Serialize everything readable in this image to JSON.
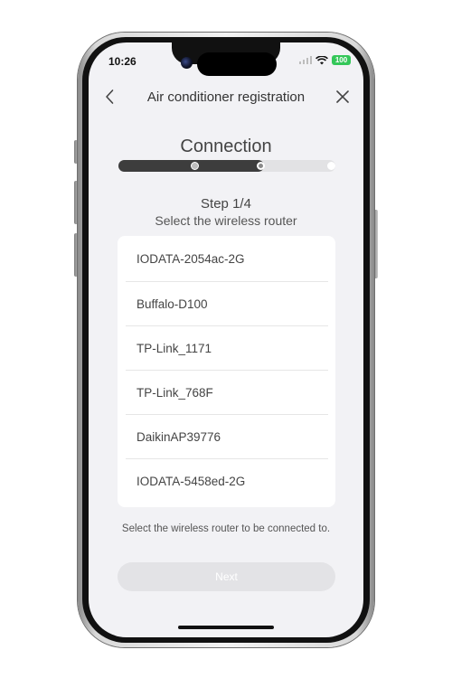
{
  "status_bar": {
    "time": "10:26",
    "battery": "100",
    "battery_color": "#34c759"
  },
  "header": {
    "title": "Air conditioner registration",
    "back_icon": "chevron-left-icon",
    "close_icon": "close-icon"
  },
  "section": {
    "title": "Connection"
  },
  "progress": {
    "value_fraction": 0.67,
    "total_steps": 3
  },
  "step": {
    "label": "Step 1/4",
    "instruction": "Select the wireless router"
  },
  "routers": [
    {
      "ssid": "IODATA-2054ac-2G"
    },
    {
      "ssid": "Buffalo-D100"
    },
    {
      "ssid": "TP-Link_1171"
    },
    {
      "ssid": "TP-Link_768F"
    },
    {
      "ssid": "DaikinAP39776"
    },
    {
      "ssid": "IODATA-5458ed-2G"
    }
  ],
  "hint": "Select the wireless router to be connected to.",
  "next_button": {
    "label": "Next",
    "enabled": false
  }
}
